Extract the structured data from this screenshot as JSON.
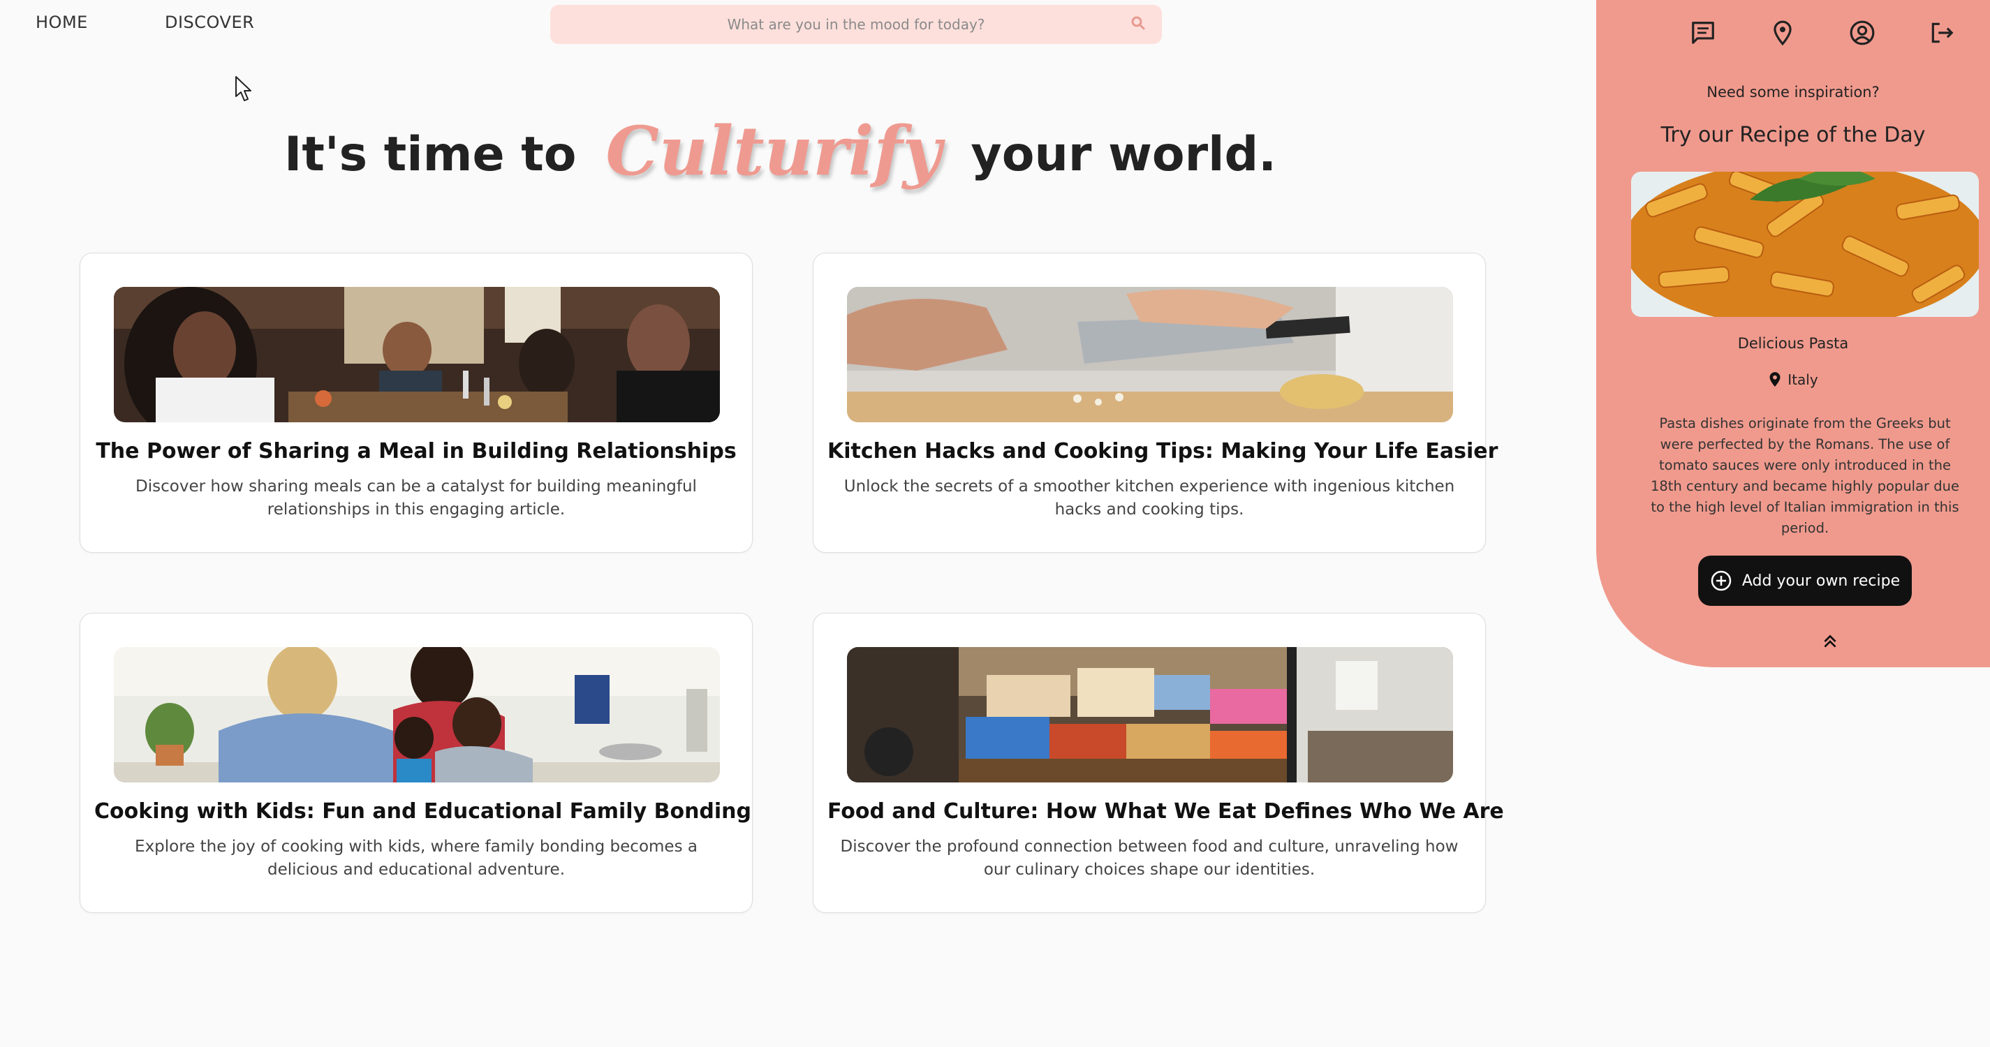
{
  "nav": {
    "home": "HOME",
    "discover": "DISCOVER",
    "search_placeholder": "What are you in the mood for today?"
  },
  "hero": {
    "prefix": "It's time to",
    "brand": "Culturify",
    "suffix": "your world."
  },
  "articles": [
    {
      "title": "The Power of Sharing a Meal in Building Relationships",
      "description": "Discover how sharing meals can be a catalyst for building meaningful relationships in this engaging article."
    },
    {
      "title": "Kitchen Hacks and Cooking Tips: Making Your Life Easier",
      "description": "Unlock the secrets of a smoother kitchen experience with ingenious kitchen hacks and cooking tips."
    },
    {
      "title": "Cooking with Kids: Fun and Educational Family Bonding",
      "description": "Explore the joy of cooking with kids, where family bonding becomes a delicious and educational adventure."
    },
    {
      "title": "Food and Culture: How What We Eat Defines Who We Are",
      "description": "Discover the profound connection between food and culture, unraveling how our culinary choices shape our identities."
    }
  ],
  "panel": {
    "icons": [
      "chat-icon",
      "location-pin-icon",
      "user-circle-icon",
      "logout-icon"
    ],
    "inspiration": "Need some inspiration?",
    "recipe_heading": "Try our Recipe of the Day",
    "recipe_name": "Delicious Pasta",
    "recipe_location": "Italy",
    "recipe_description": "Pasta dishes originate from the Greeks but were perfected by the Romans. The use of tomato sauces were only introduced in the 18th century and became highly popular due to the high level of Italian immigration in this period.",
    "add_button": "Add your own recipe",
    "collapse_icon": "chevron-double-up-icon"
  },
  "colors": {
    "accent": "#f09a8d",
    "search_bg": "#fde0dc",
    "button_bg": "#111111"
  }
}
